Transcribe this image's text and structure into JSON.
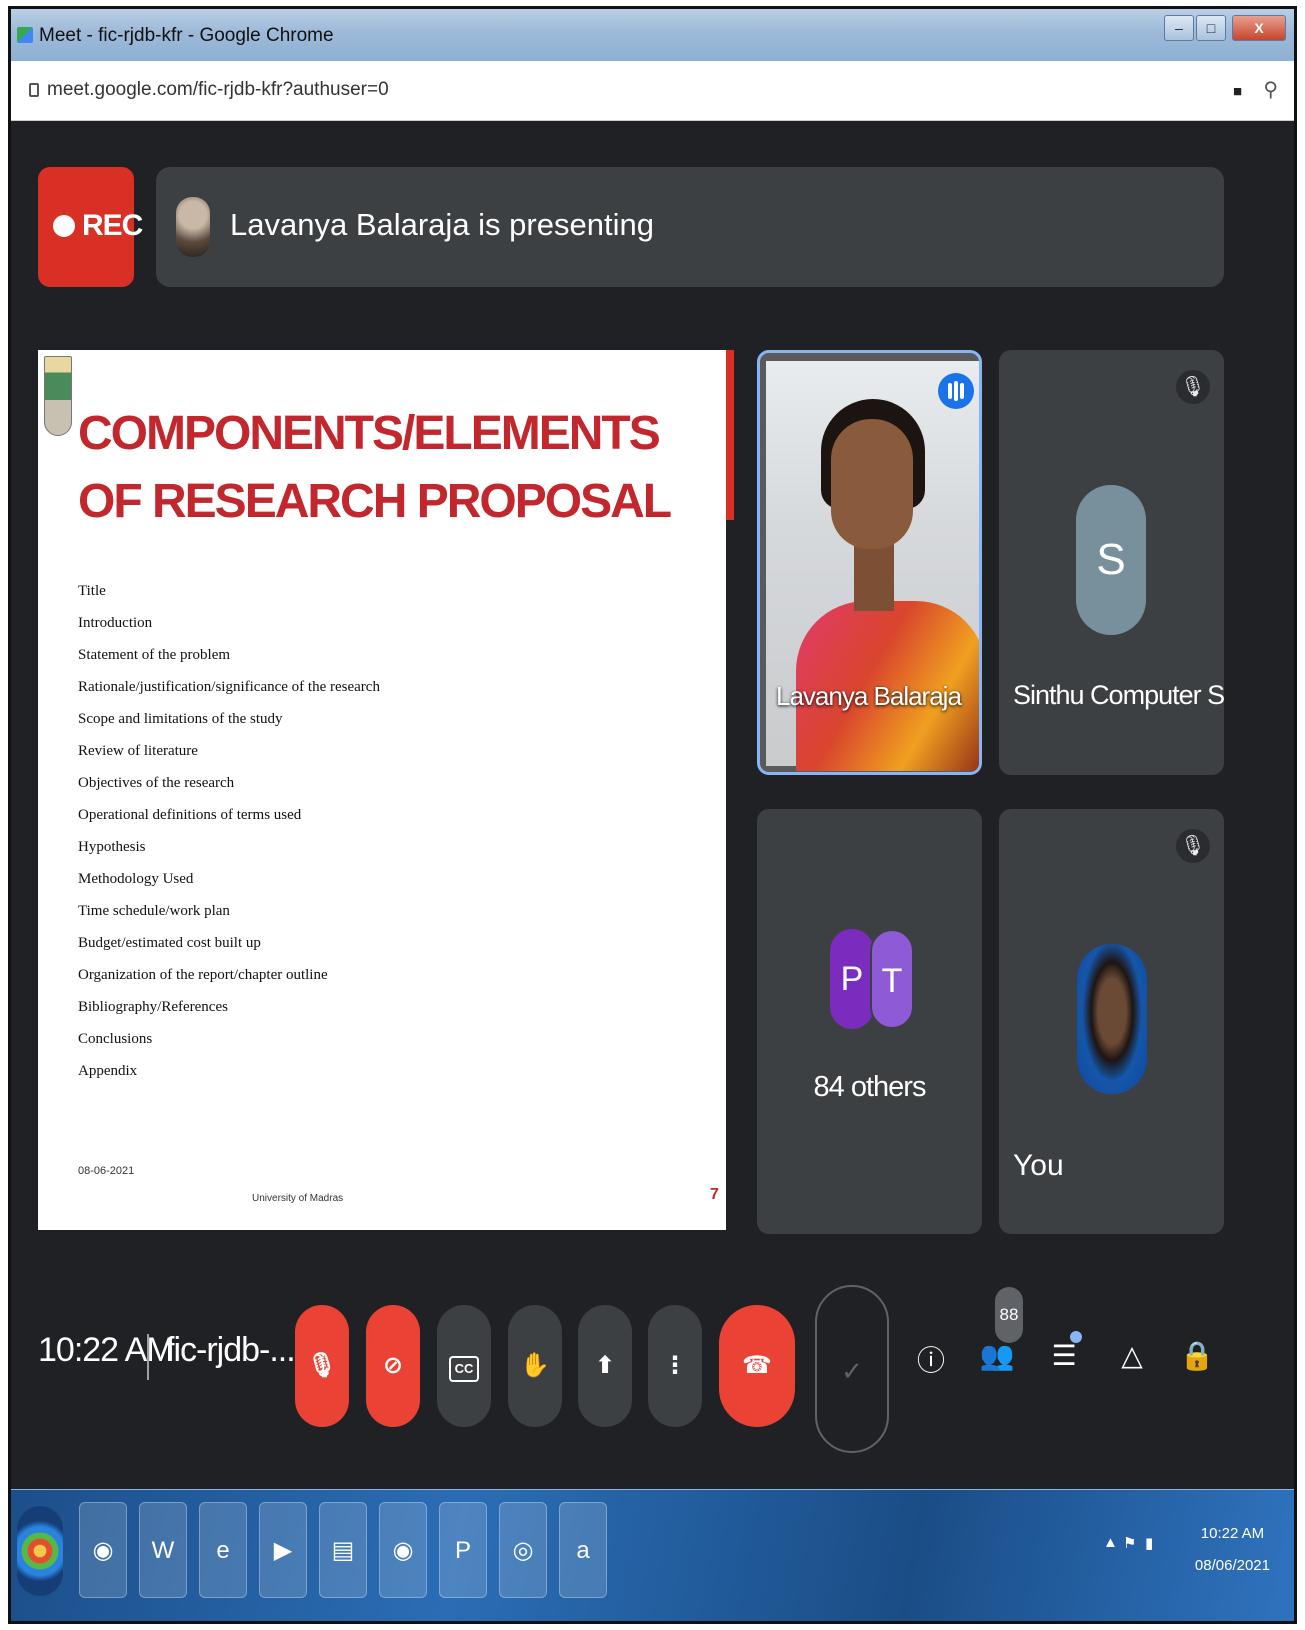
{
  "browser": {
    "window_title": "Meet - fic-rjdb-kfr - Google Chrome",
    "url": "meet.google.com/fic-rjdb-kfr?authuser=0",
    "window_controls": {
      "minimize": "–",
      "maximize": "□",
      "close": "X"
    }
  },
  "meet": {
    "rec_label": "REC",
    "presenting_text": "Lavanya Balaraja is presenting",
    "slide": {
      "title": "COMPONENTS/ELEMENTS OF RESEARCH PROPOSAL",
      "items": [
        "Title",
        "Introduction",
        "Statement of the problem",
        "Rationale/justification/significance of the research",
        "Scope and limitations of the study",
        "Review of literature",
        "Objectives of the research",
        "Operational definitions of terms used",
        "Hypothesis",
        "Methodology Used",
        "Time schedule/work plan",
        "Budget/estimated cost built up",
        "Organization of the report/chapter outline",
        "Bibliography/References",
        "Conclusions",
        "Appendix"
      ],
      "date": "08-06-2021",
      "footer": "University of Madras",
      "page_number": "7"
    },
    "tiles": {
      "presenter": {
        "name": "Lavanya Balaraja",
        "status": "speaking"
      },
      "sinthu": {
        "name": "Sinthu Computer Sc...",
        "initial": "S",
        "mic": "muted"
      },
      "others": {
        "initials": [
          "P",
          "T"
        ],
        "label": "84 others"
      },
      "self": {
        "name": "You",
        "mic": "muted"
      }
    },
    "bottom_bar": {
      "time": "10:22 AM",
      "meeting_code": "fic-rjdb-...",
      "cc_label": "CC",
      "people_count": "88",
      "check_symbol": "✓"
    }
  },
  "taskbar": {
    "time": "10:22 AM",
    "date": "08/06/2021",
    "apps": [
      "chrome",
      "word",
      "internet-explorer",
      "media-player",
      "notepad",
      "chrome",
      "powerpoint",
      "chrome-canary",
      "airtel"
    ]
  },
  "colors": {
    "meet_background": "#202124",
    "rec_red": "#d93025",
    "slide_title_red": "#c1272d",
    "active_border": "#8ab4f8",
    "leave_button": "#ea4335",
    "taskbar_blue": "#2b6db5"
  }
}
